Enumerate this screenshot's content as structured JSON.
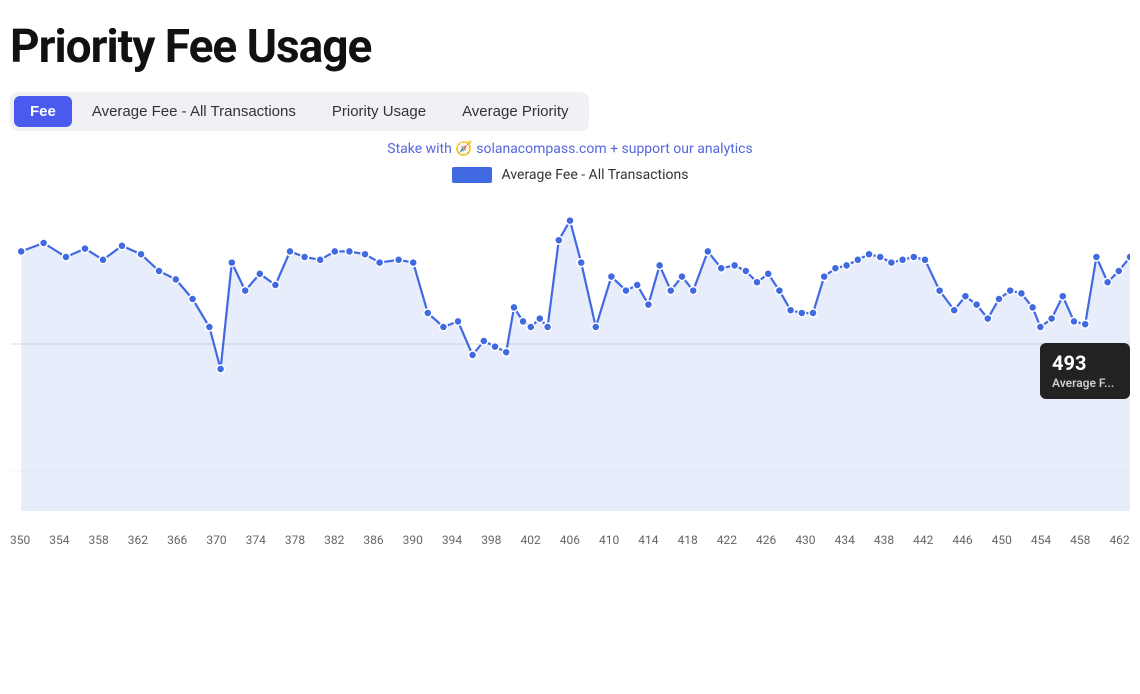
{
  "page": {
    "title": "Priority Fee Usage"
  },
  "tabs": [
    {
      "id": "fee",
      "label": "Fee",
      "active": true
    },
    {
      "id": "avg-fee",
      "label": "Average Fee - All Transactions",
      "active": false
    },
    {
      "id": "priority-usage",
      "label": "Priority Usage",
      "active": false
    },
    {
      "id": "avg-priority",
      "label": "Average Priority",
      "active": false
    }
  ],
  "stake_text": "Stake with 🧭 solanacompass.com + support our analytics",
  "legend": {
    "label": "Average Fee - All Transactions",
    "color": "#4169e1"
  },
  "tooltip": {
    "value": "493",
    "label": "Average F..."
  },
  "x_axis_labels": [
    "350",
    "354",
    "358",
    "362",
    "366",
    "370",
    "374",
    "378",
    "382",
    "386",
    "390",
    "394",
    "398",
    "402",
    "406",
    "410",
    "414",
    "418",
    "422",
    "426",
    "430",
    "434",
    "438",
    "442",
    "446",
    "450",
    "454",
    "458",
    "462"
  ],
  "chart": {
    "grid_line_y": 0.45,
    "data_points": [
      {
        "x": 0.01,
        "y": 0.82
      },
      {
        "x": 0.03,
        "y": 0.85
      },
      {
        "x": 0.05,
        "y": 0.8
      },
      {
        "x": 0.067,
        "y": 0.83
      },
      {
        "x": 0.083,
        "y": 0.79
      },
      {
        "x": 0.1,
        "y": 0.84
      },
      {
        "x": 0.117,
        "y": 0.81
      },
      {
        "x": 0.133,
        "y": 0.75
      },
      {
        "x": 0.148,
        "y": 0.72
      },
      {
        "x": 0.163,
        "y": 0.65
      },
      {
        "x": 0.178,
        "y": 0.55
      },
      {
        "x": 0.188,
        "y": 0.4
      },
      {
        "x": 0.198,
        "y": 0.78
      },
      {
        "x": 0.21,
        "y": 0.68
      },
      {
        "x": 0.223,
        "y": 0.74
      },
      {
        "x": 0.237,
        "y": 0.7
      },
      {
        "x": 0.25,
        "y": 0.82
      },
      {
        "x": 0.263,
        "y": 0.8
      },
      {
        "x": 0.277,
        "y": 0.79
      },
      {
        "x": 0.29,
        "y": 0.82
      },
      {
        "x": 0.303,
        "y": 0.82
      },
      {
        "x": 0.317,
        "y": 0.81
      },
      {
        "x": 0.33,
        "y": 0.78
      },
      {
        "x": 0.347,
        "y": 0.79
      },
      {
        "x": 0.36,
        "y": 0.78
      },
      {
        "x": 0.373,
        "y": 0.6
      },
      {
        "x": 0.387,
        "y": 0.55
      },
      {
        "x": 0.4,
        "y": 0.57
      },
      {
        "x": 0.413,
        "y": 0.45
      },
      {
        "x": 0.423,
        "y": 0.5
      },
      {
        "x": 0.433,
        "y": 0.48
      },
      {
        "x": 0.443,
        "y": 0.46
      },
      {
        "x": 0.45,
        "y": 0.62
      },
      {
        "x": 0.458,
        "y": 0.57
      },
      {
        "x": 0.465,
        "y": 0.55
      },
      {
        "x": 0.473,
        "y": 0.58
      },
      {
        "x": 0.48,
        "y": 0.55
      },
      {
        "x": 0.49,
        "y": 0.86
      },
      {
        "x": 0.5,
        "y": 0.93
      },
      {
        "x": 0.51,
        "y": 0.78
      },
      {
        "x": 0.523,
        "y": 0.55
      },
      {
        "x": 0.537,
        "y": 0.73
      },
      {
        "x": 0.55,
        "y": 0.68
      },
      {
        "x": 0.56,
        "y": 0.7
      },
      {
        "x": 0.57,
        "y": 0.63
      },
      {
        "x": 0.58,
        "y": 0.77
      },
      {
        "x": 0.59,
        "y": 0.68
      },
      {
        "x": 0.6,
        "y": 0.73
      },
      {
        "x": 0.61,
        "y": 0.68
      },
      {
        "x": 0.623,
        "y": 0.82
      },
      {
        "x": 0.635,
        "y": 0.76
      },
      {
        "x": 0.647,
        "y": 0.77
      },
      {
        "x": 0.657,
        "y": 0.75
      },
      {
        "x": 0.667,
        "y": 0.71
      },
      {
        "x": 0.677,
        "y": 0.74
      },
      {
        "x": 0.687,
        "y": 0.68
      },
      {
        "x": 0.697,
        "y": 0.61
      },
      {
        "x": 0.707,
        "y": 0.6
      },
      {
        "x": 0.717,
        "y": 0.6
      },
      {
        "x": 0.727,
        "y": 0.73
      },
      {
        "x": 0.737,
        "y": 0.76
      },
      {
        "x": 0.747,
        "y": 0.77
      },
      {
        "x": 0.757,
        "y": 0.79
      },
      {
        "x": 0.767,
        "y": 0.81
      },
      {
        "x": 0.777,
        "y": 0.8
      },
      {
        "x": 0.787,
        "y": 0.78
      },
      {
        "x": 0.797,
        "y": 0.79
      },
      {
        "x": 0.807,
        "y": 0.8
      },
      {
        "x": 0.817,
        "y": 0.79
      },
      {
        "x": 0.83,
        "y": 0.68
      },
      {
        "x": 0.843,
        "y": 0.61
      },
      {
        "x": 0.853,
        "y": 0.66
      },
      {
        "x": 0.863,
        "y": 0.63
      },
      {
        "x": 0.873,
        "y": 0.58
      },
      {
        "x": 0.883,
        "y": 0.65
      },
      {
        "x": 0.893,
        "y": 0.68
      },
      {
        "x": 0.903,
        "y": 0.67
      },
      {
        "x": 0.913,
        "y": 0.62
      },
      {
        "x": 0.92,
        "y": 0.55
      },
      {
        "x": 0.93,
        "y": 0.58
      },
      {
        "x": 0.94,
        "y": 0.66
      },
      {
        "x": 0.95,
        "y": 0.57
      },
      {
        "x": 0.96,
        "y": 0.56
      },
      {
        "x": 0.97,
        "y": 0.8
      },
      {
        "x": 0.98,
        "y": 0.71
      },
      {
        "x": 0.99,
        "y": 0.75
      },
      {
        "x": 1.0,
        "y": 0.8
      }
    ]
  }
}
